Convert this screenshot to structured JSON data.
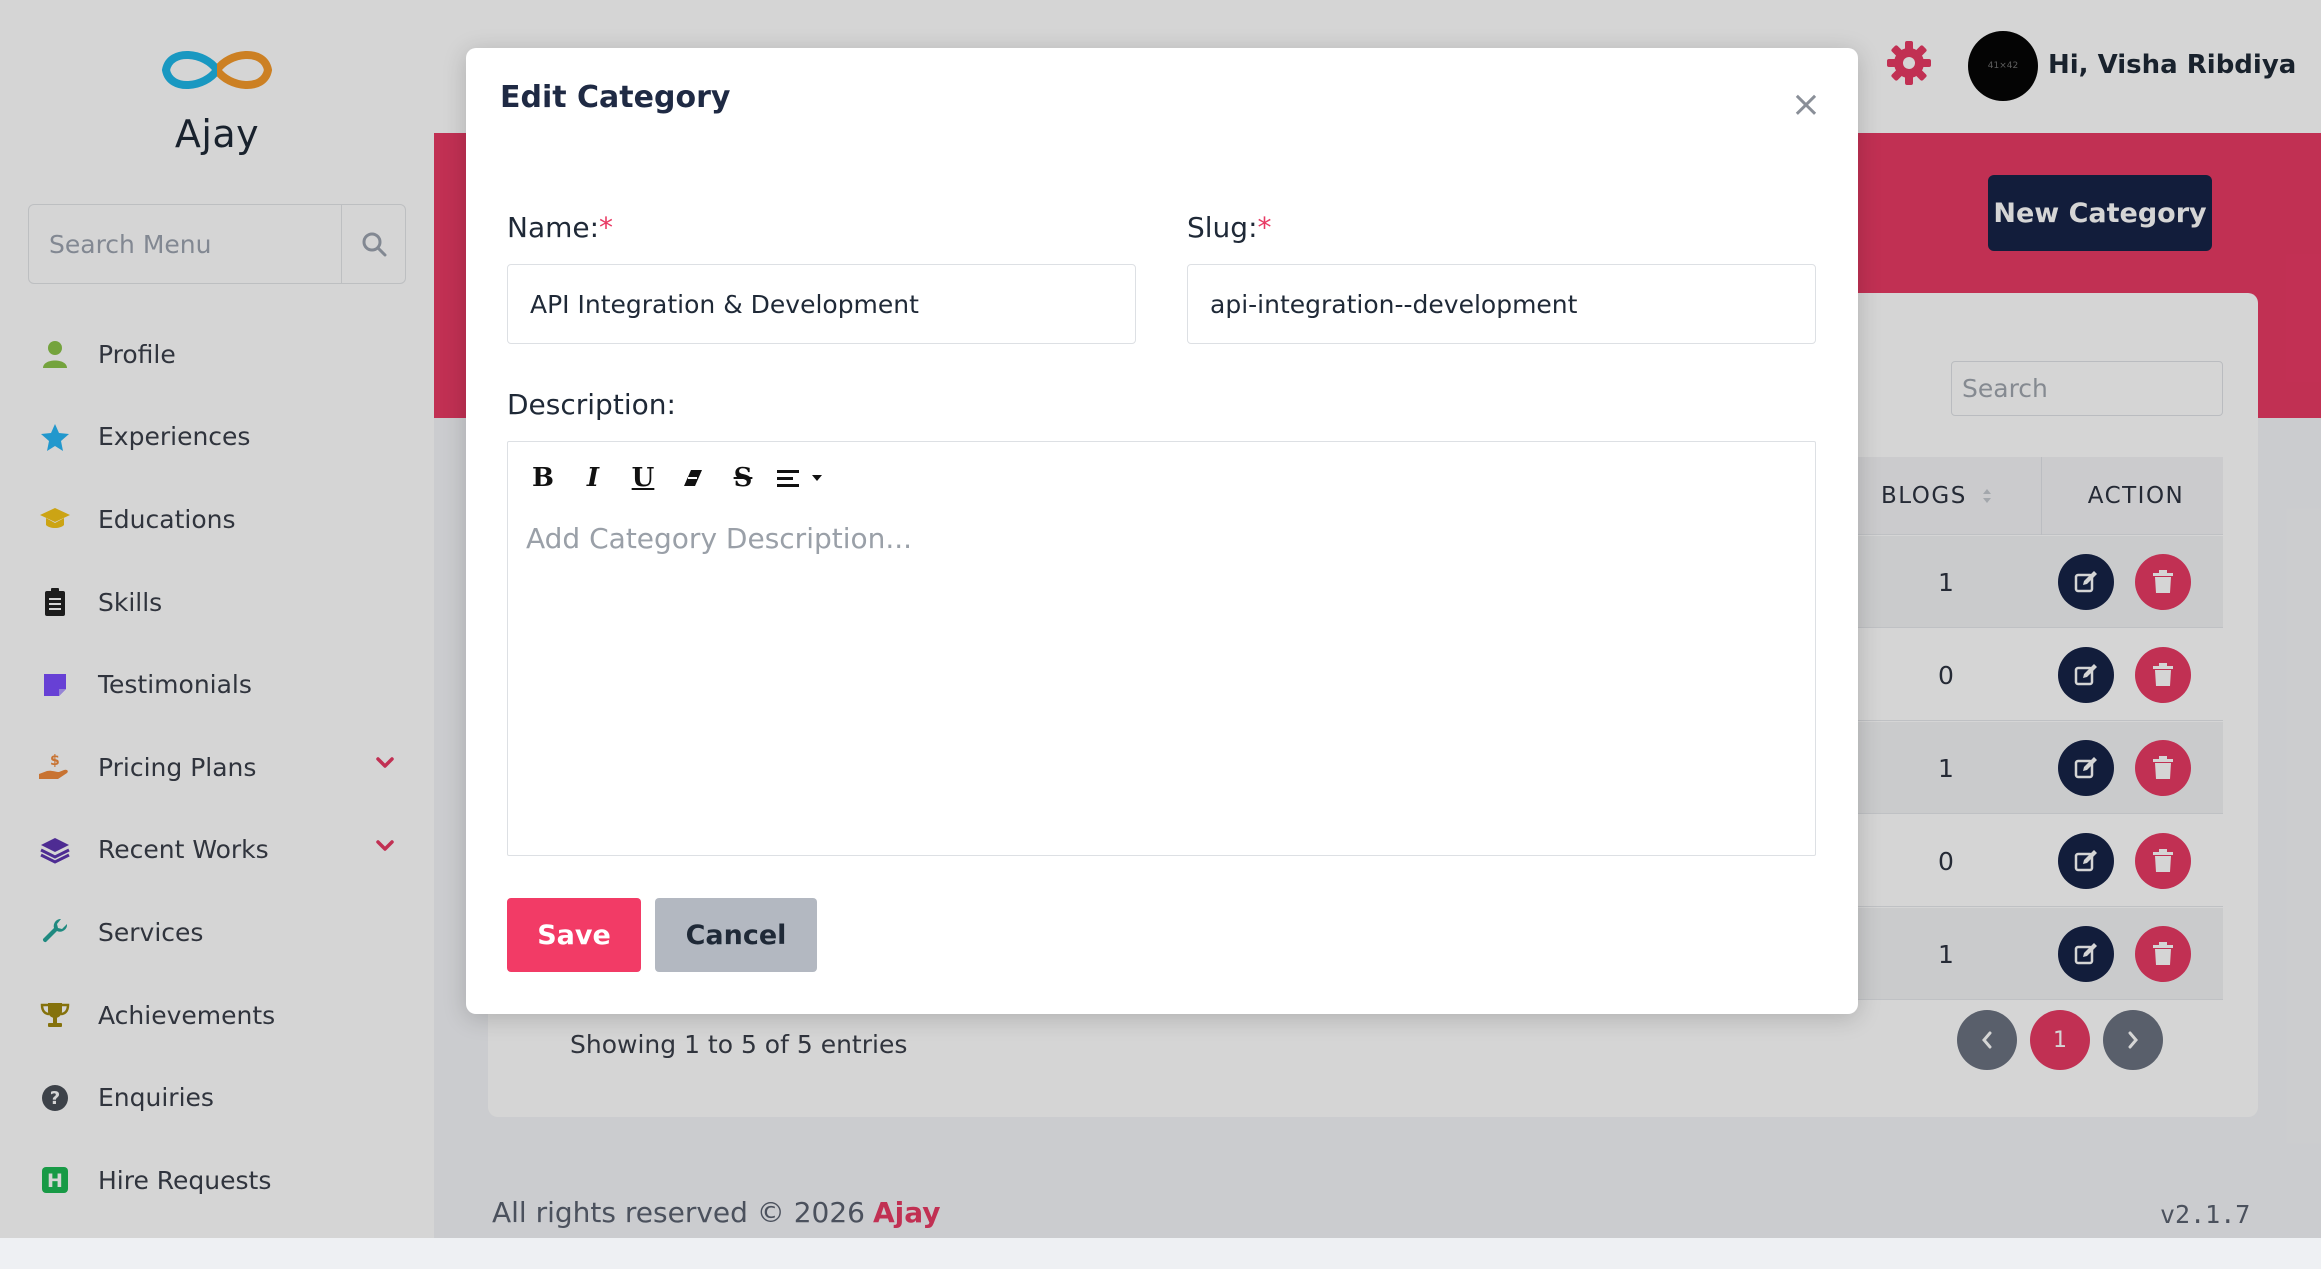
{
  "sidebar": {
    "brand": "Ajay",
    "search_placeholder": "Search Menu",
    "items": [
      {
        "label": "Profile",
        "icon": "user-icon",
        "color": "#8bc34a"
      },
      {
        "label": "Experiences",
        "icon": "star-icon",
        "color": "#29b6f6"
      },
      {
        "label": "Educations",
        "icon": "graduation-cap-icon",
        "color": "#f5c518"
      },
      {
        "label": "Skills",
        "icon": "clipboard-icon",
        "color": "#222222"
      },
      {
        "label": "Testimonials",
        "icon": "sticky-note-icon",
        "color": "#7c4dff"
      },
      {
        "label": "Pricing Plans",
        "icon": "hand-dollar-icon",
        "color": "#f08a3c",
        "has_submenu": true
      },
      {
        "label": "Recent Works",
        "icon": "layers-icon",
        "color": "#5e35b1",
        "has_submenu": true
      },
      {
        "label": "Services",
        "icon": "wrench-icon",
        "color": "#26a69a"
      },
      {
        "label": "Achievements",
        "icon": "trophy-icon",
        "color": "#a0890f"
      },
      {
        "label": "Enquiries",
        "icon": "question-circle-icon",
        "color": "#4a4f58"
      },
      {
        "label": "Hire Requests",
        "icon": "h-square-icon",
        "color": "#1db954"
      }
    ]
  },
  "header": {
    "avatar_text": "41×42",
    "greeting": "Hi,  Visha Ribdiya"
  },
  "page": {
    "new_category_label": "New Category",
    "table_search_placeholder": "Search",
    "columns": [
      "BLOGS",
      "ACTION"
    ],
    "rows": [
      {
        "blogs": "1"
      },
      {
        "blogs": "0"
      },
      {
        "blogs": "1"
      },
      {
        "blogs": "0"
      },
      {
        "blogs": "1"
      }
    ],
    "showing": "Showing 1 to 5 of 5 entries",
    "current_page": "1"
  },
  "footer": {
    "rights": "All rights reserved © 2026",
    "brand": "Ajay",
    "version": "v2.1.7"
  },
  "modal": {
    "title": "Edit Category",
    "close": "×",
    "name_label": "Name:",
    "name_value": "API Integration & Development",
    "slug_label": "Slug:",
    "slug_value": "api-integration--development",
    "required_mark": "*",
    "description_label": "Description:",
    "description_placeholder": "Add Category Description...",
    "toolbar": {
      "bold": "B",
      "italic": "I",
      "underline": "U",
      "strike": "S"
    },
    "save_label": "Save",
    "cancel_label": "Cancel"
  },
  "colors": {
    "accent": "#e83a64",
    "navy": "#162347"
  }
}
